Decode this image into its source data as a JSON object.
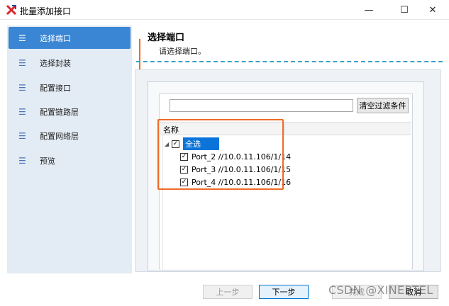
{
  "window": {
    "title": "批量添加接口",
    "controls": {
      "minimize": "—",
      "maximize": "☐",
      "close": "✕"
    }
  },
  "sidebar": {
    "items": [
      {
        "icon": "list-icon",
        "label": "选择端口",
        "active": true
      },
      {
        "icon": "list-icon",
        "label": "选择封装",
        "active": false
      },
      {
        "icon": "list-icon",
        "label": "配置接口",
        "active": false
      },
      {
        "icon": "list-icon",
        "label": "配置链路层",
        "active": false
      },
      {
        "icon": "list-icon",
        "label": "配置网络层",
        "active": false
      },
      {
        "icon": "list-icon",
        "label": "预览",
        "active": false
      }
    ]
  },
  "main": {
    "title": "选择端口",
    "subtitle": "请选择端口。",
    "filter": {
      "value": "",
      "clear_label": "清空过滤条件"
    },
    "grid": {
      "column": "名称",
      "select_all": {
        "label": "全选",
        "checked": true
      },
      "ports": [
        {
          "label": "Port_2 //10.0.11.106/1/14",
          "checked": true
        },
        {
          "label": "Port_3 //10.0.11.106/1/15",
          "checked": true
        },
        {
          "label": "Port_4 //10.0.11.106/1/16",
          "checked": true
        }
      ]
    }
  },
  "footer": {
    "prev_label": "上一步",
    "next_label": "下一步",
    "finish_label": "完成",
    "cancel_label": "取消"
  },
  "watermark": "CSDN @XINERTEL",
  "colors": {
    "accent": "#3a86d4",
    "selection": "#0a74da",
    "annotation": "#f06b25",
    "divider": "#3aa0c8"
  }
}
